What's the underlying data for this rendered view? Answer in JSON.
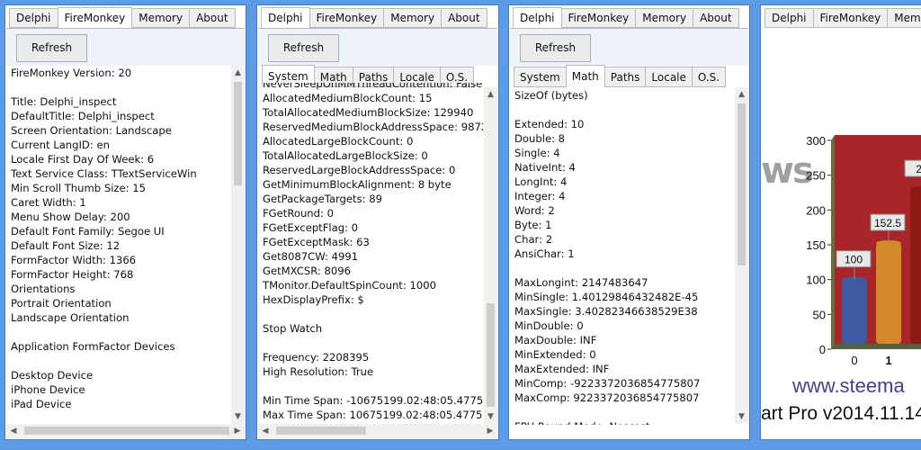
{
  "tabs": [
    "Delphi",
    "FireMonkey",
    "Memory",
    "About"
  ],
  "refresh_label": "Refresh",
  "subtabs": [
    "System",
    "Math",
    "Paths",
    "Locale",
    "O.S."
  ],
  "panel1": {
    "active_tab": "FireMonkey",
    "lines": [
      "FireMonkey Version: 20",
      "",
      "Title: Delphi_inspect",
      "DefaultTitle: Delphi_inspect",
      "Screen Orientation: Landscape",
      "Current LangID: en",
      "Locale First Day Of Week: 6",
      "Text Service Class: TTextServiceWin",
      "Min Scroll Thumb Size: 15",
      "Caret Width: 1",
      "Menu Show Delay: 200",
      "Default Font Family: Segoe UI",
      "Default Font Size: 12",
      "FormFactor Width: 1366",
      "FormFactor Height: 768",
      "Orientations",
      "Portrait Orientation",
      "Landscape Orientation",
      "",
      "Application FormFactor Devices",
      "",
      "Desktop Device",
      "iPhone Device",
      "iPad Device"
    ]
  },
  "panel2": {
    "active_tab": "Delphi",
    "active_subtab": "System",
    "partial_top_line": "NeverSleepOnMMThreadContention: False",
    "lines": [
      "AllocatedMediumBlockCount: 15",
      "TotalAllocatedMediumBlockSize: 129940",
      "ReservedMediumBlockAddressSpace: 987264",
      "AllocatedLargeBlockCount: 0",
      "TotalAllocatedLargeBlockSize: 0",
      "ReservedLargeBlockAddressSpace: 0",
      "GetMinimumBlockAlignment: 8 byte",
      "GetPackageTargets: 89",
      "FGetRound: 0",
      "FGetExceptFlag: 0",
      "FGetExceptMask: 63",
      "Get8087CW: 4991",
      "GetMXCSR: 8096",
      "TMonitor.DefaultSpinCount: 1000",
      "HexDisplayPrefix: $",
      "",
      "Stop Watch",
      "",
      "Frequency: 2208395",
      "High Resolution: True",
      "",
      "Min Time Span: -10675199.02:48:05.4775808",
      "Max Time Span: 10675199.02:48:05.4775807"
    ]
  },
  "panel3": {
    "active_tab": "Delphi",
    "active_subtab": "Math",
    "lines": [
      "SizeOf (bytes)",
      "",
      "Extended: 10",
      "Double: 8",
      "Single: 4",
      "NativeInt: 4",
      "LongInt: 4",
      "Integer: 4",
      "Word: 2",
      "Byte: 1",
      "Char: 2",
      "AnsiChar: 1",
      "",
      "MaxLongint: 2147483647",
      "MinSingle: 1.40129846432482E-45",
      "MaxSingle: 3.40282346638529E38",
      "MinDouble: 0",
      "MaxDouble: INF",
      "MinExtended: 0",
      "MaxExtended: INF",
      "MinComp: -9223372036854775807",
      "MaxComp: 9223372036854775807",
      "",
      "FPU Round Mode: Nearest"
    ]
  },
  "panel4": {
    "active_tab": "About",
    "visible_tabs": [
      "Delphi",
      "FireMonkey",
      "Memo"
    ],
    "brand_fragment": "ws",
    "website": "www.steema",
    "version": "art Pro v2014.11.14",
    "chart_data": {
      "type": "bar",
      "categories": [
        "0",
        "1",
        ""
      ],
      "values": [
        100,
        152.5,
        230
      ],
      "data_labels": [
        "100",
        "152.5",
        "23"
      ],
      "ylim": [
        0,
        300
      ],
      "yticks": [
        "0",
        "50",
        "100",
        "150",
        "200",
        "250",
        "300"
      ],
      "xticks": [
        "0",
        "1"
      ],
      "colors": [
        "#3d5aa3",
        "#d38a2a",
        "#8a1a12"
      ]
    }
  }
}
